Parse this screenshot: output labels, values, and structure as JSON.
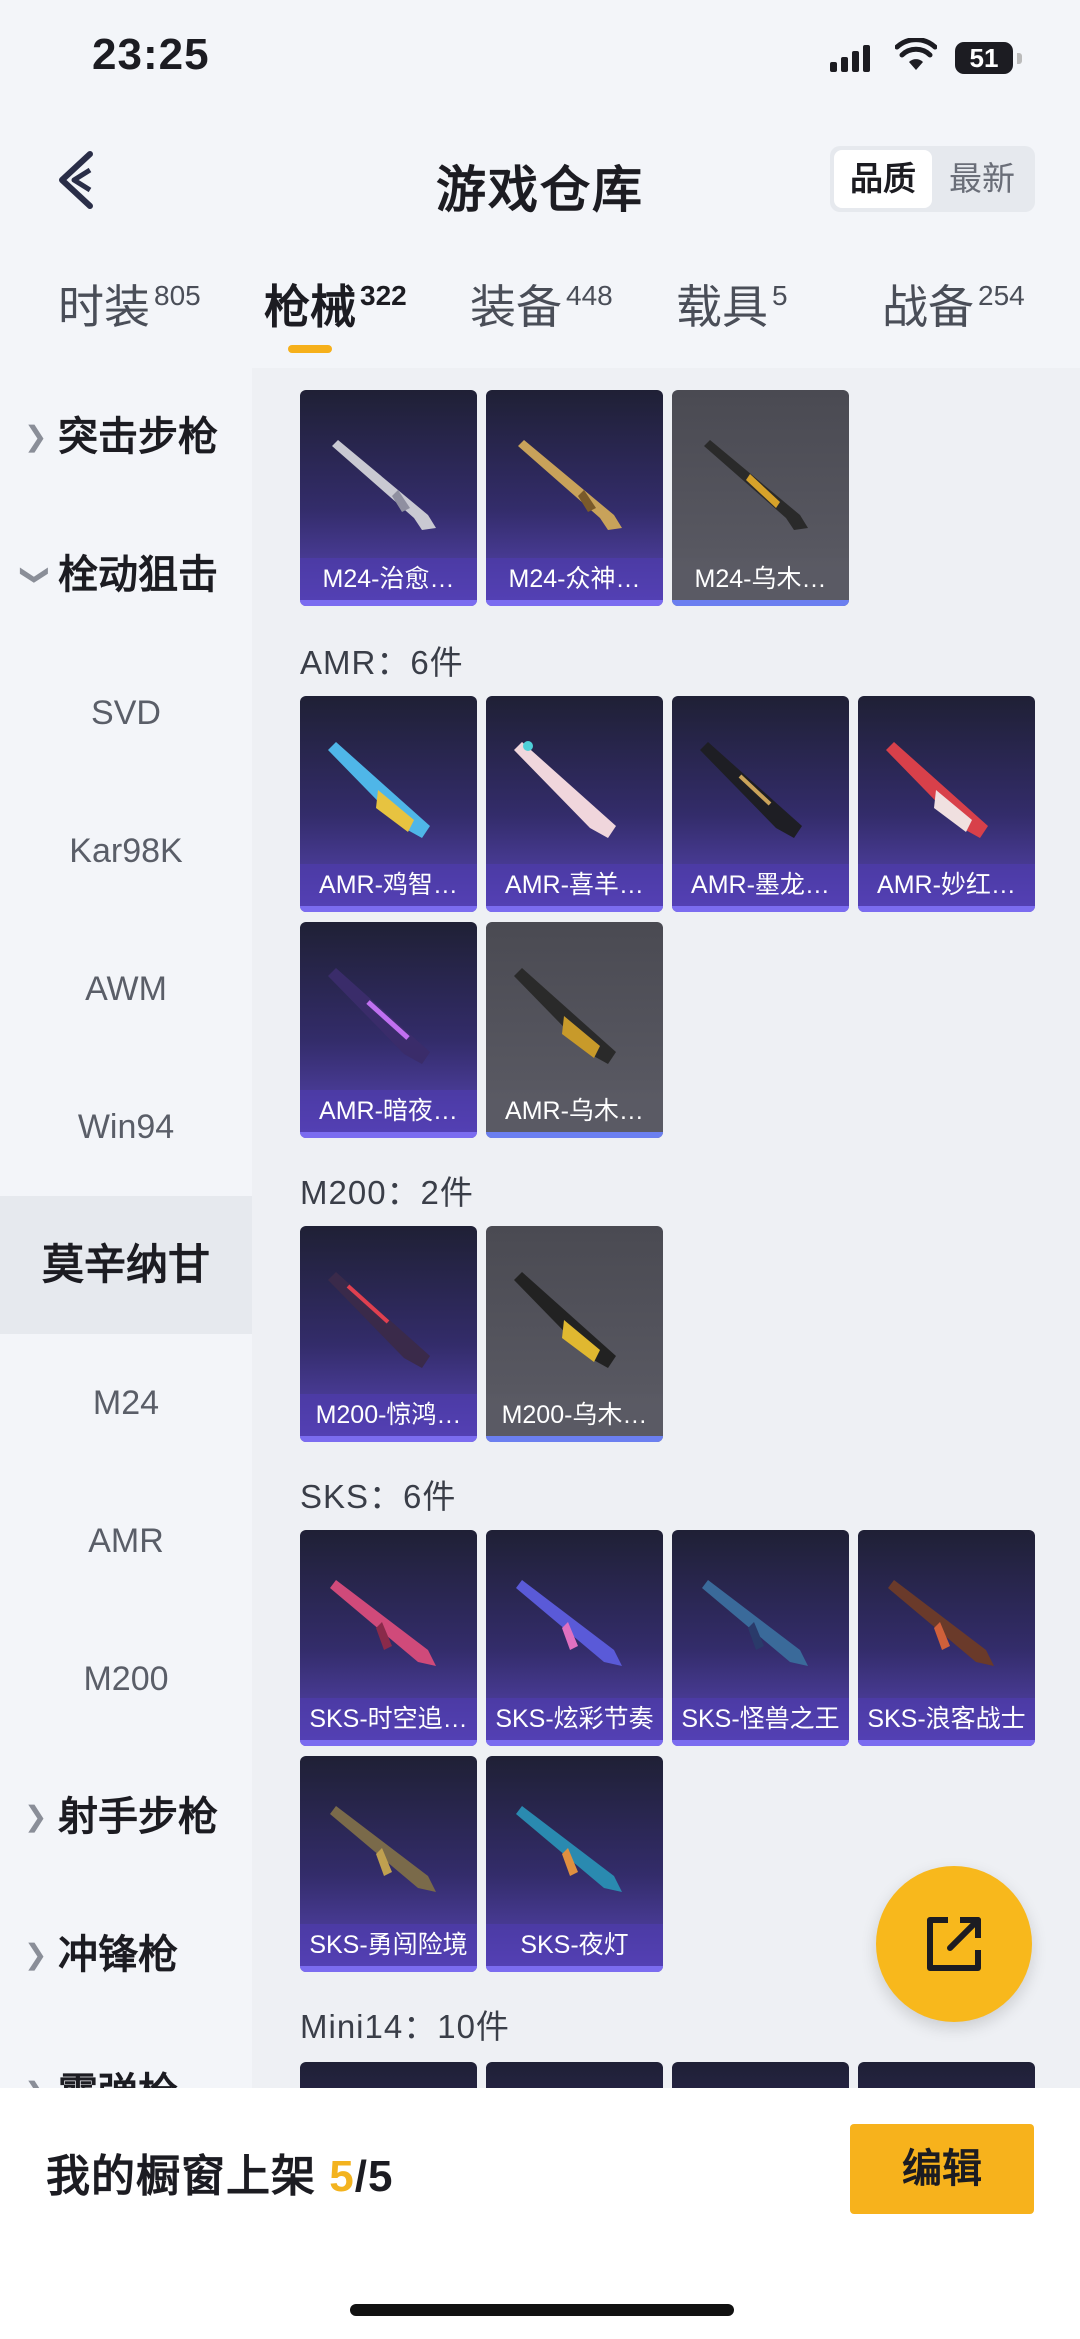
{
  "status": {
    "time": "23:25",
    "battery": "51"
  },
  "header": {
    "title": "游戏仓库",
    "sort_quality": "品质",
    "sort_latest": "最新"
  },
  "tabs": [
    {
      "label": "时装",
      "count": "805"
    },
    {
      "label": "枪械",
      "count": "322"
    },
    {
      "label": "装备",
      "count": "448"
    },
    {
      "label": "载具",
      "count": "5"
    },
    {
      "label": "战备",
      "count": "254"
    }
  ],
  "sidebar": {
    "items": [
      {
        "label": "突击步枪"
      },
      {
        "label": "栓动狙击"
      },
      {
        "label": "SVD"
      },
      {
        "label": "Kar98K"
      },
      {
        "label": "AWM"
      },
      {
        "label": "Win94"
      },
      {
        "label": "莫辛纳甘"
      },
      {
        "label": "M24"
      },
      {
        "label": "AMR"
      },
      {
        "label": "M200"
      },
      {
        "label": "射手步枪"
      },
      {
        "label": "冲锋枪"
      },
      {
        "label": "霰弹枪"
      }
    ]
  },
  "sections": {
    "m24": {
      "cards": [
        "M24-治愈…",
        "M24-众神…",
        "M24-乌木…"
      ]
    },
    "amr": {
      "title": "AMR：6件",
      "cards": [
        "AMR-鸡智…",
        "AMR-喜羊…",
        "AMR-墨龙…",
        "AMR-妙红…",
        "AMR-暗夜…",
        "AMR-乌木…"
      ]
    },
    "m200": {
      "title": "M200：2件",
      "cards": [
        "M200-惊鸿…",
        "M200-乌木…"
      ]
    },
    "sks": {
      "title": "SKS：6件",
      "cards": [
        "SKS-时空追…",
        "SKS-炫彩节奏",
        "SKS-怪兽之王",
        "SKS-浪客战士",
        "SKS-勇闯险境",
        "SKS-夜灯"
      ]
    },
    "mini14": {
      "title": "Mini14：10件"
    }
  },
  "bottom": {
    "showcase_label": "我的橱窗上架",
    "showcase_count": "5",
    "showcase_total": "/5",
    "edit_label": "编辑"
  },
  "colors": {
    "accent": "#f7b21c",
    "card_purple": "#332c6a",
    "card_gray": "#55555e"
  }
}
